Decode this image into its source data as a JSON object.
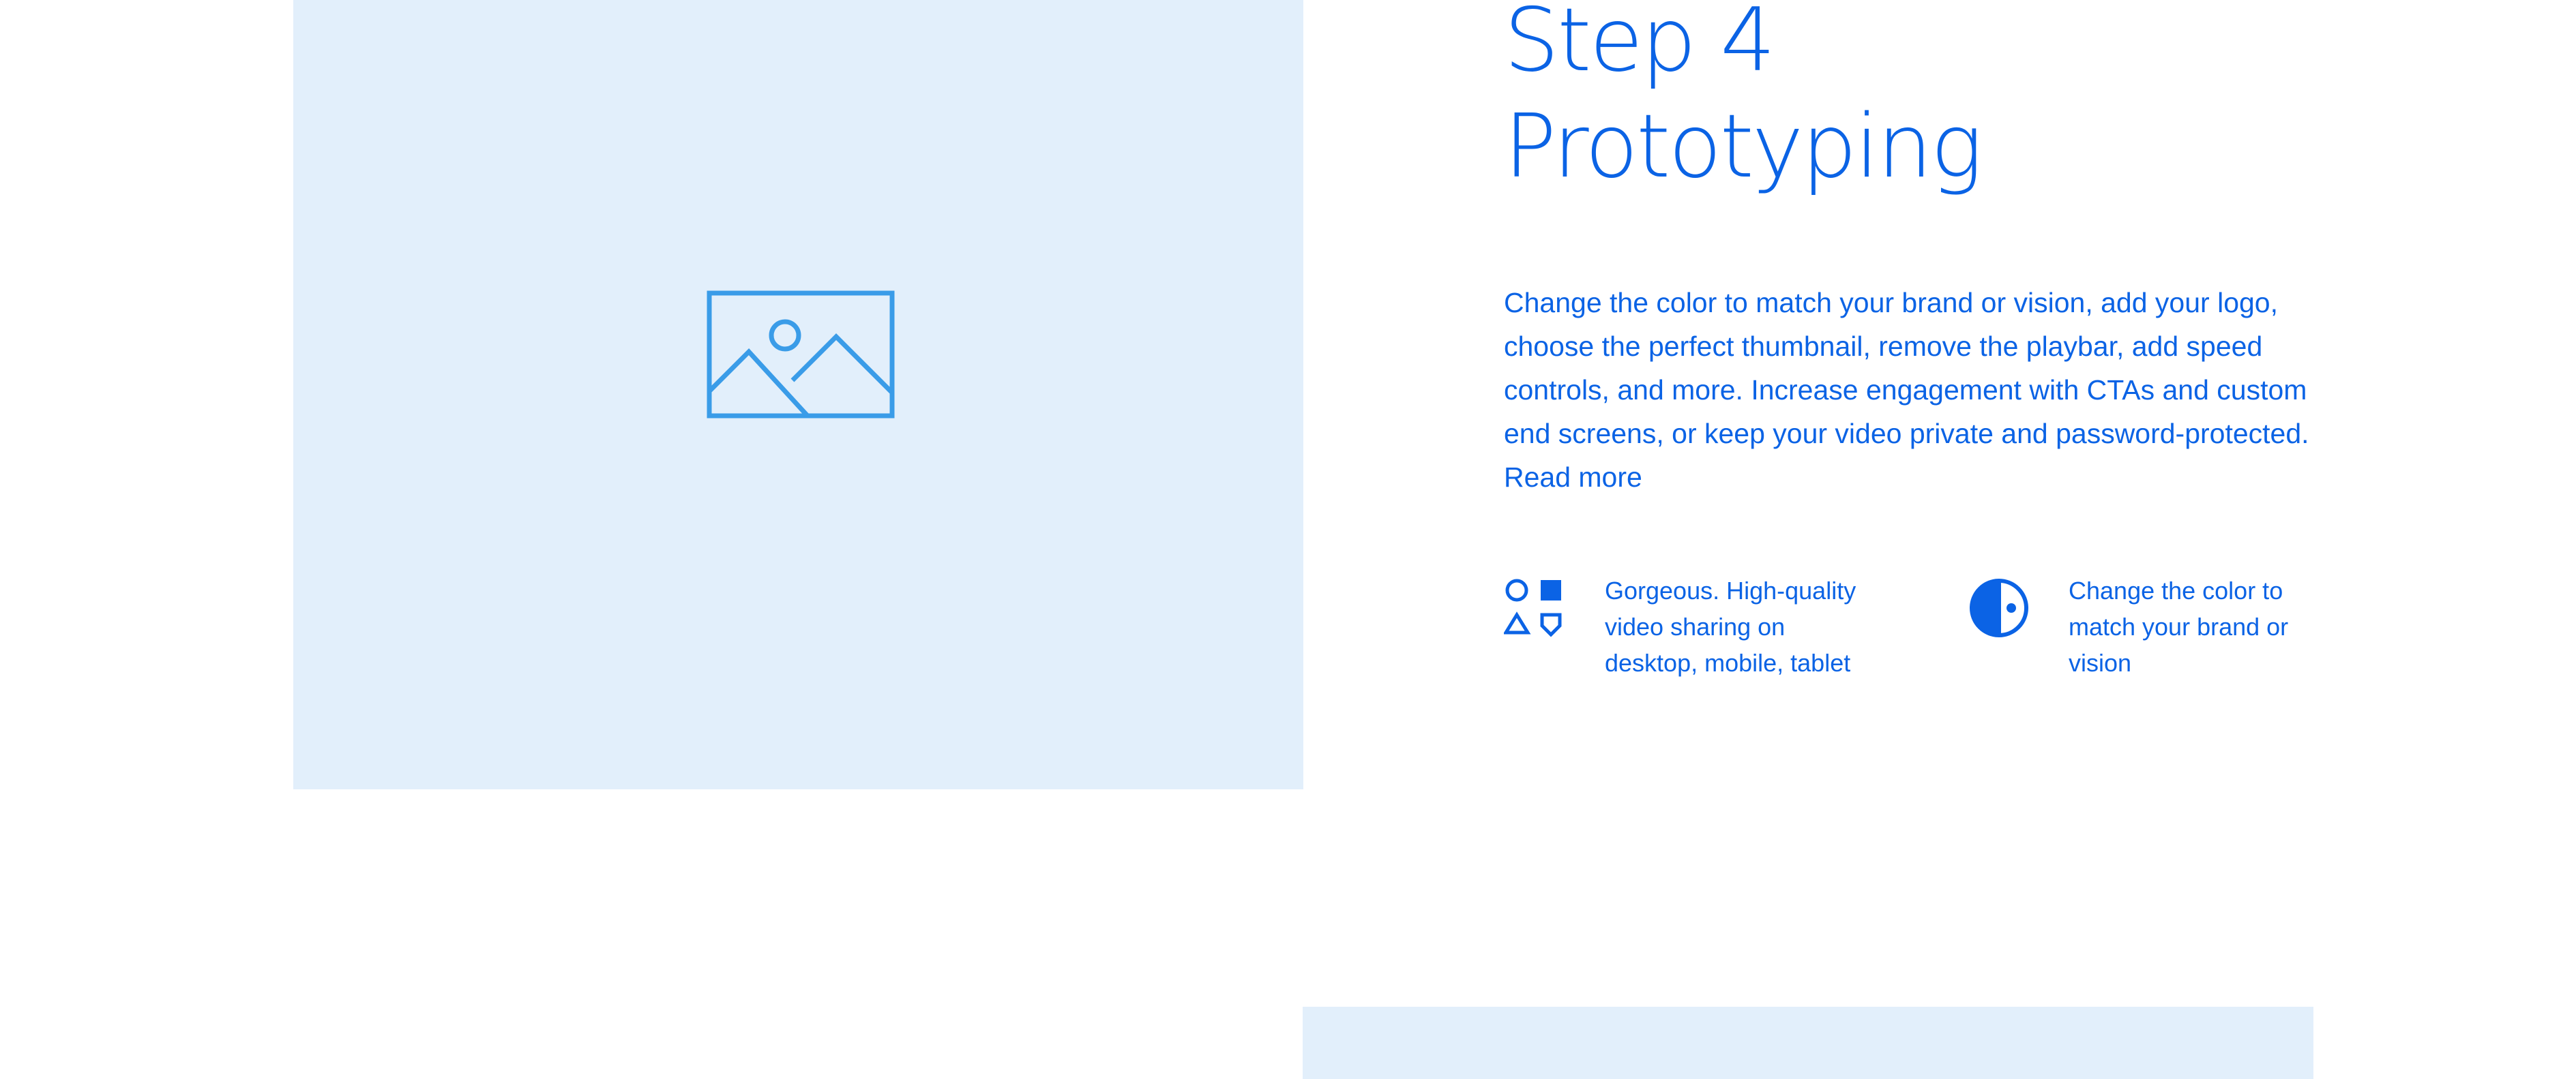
{
  "section": {
    "title_line1": "Step 4",
    "title_line2": "Prototyping",
    "description": "Change the color to match your brand or vision, add your logo, choose the perfect thumbnail, remove the playbar, add speed controls, and more. Increase engagement with CTAs and custom end screens, or keep your video private and password-protected.",
    "read_more_label": "Read more"
  },
  "media": {
    "icon": "image-placeholder-icon"
  },
  "features": [
    {
      "icon": "shapes-icon",
      "text": "Gorgeous. High-quality video sharing on desktop, mobile, tablet"
    },
    {
      "icon": "half-circle-contrast-icon",
      "text": "Change the color to match your brand or vision"
    }
  ],
  "colors": {
    "accent": "#0b63e5",
    "icon_light": "#3a9ce8",
    "panel_background": "#e2effb"
  }
}
